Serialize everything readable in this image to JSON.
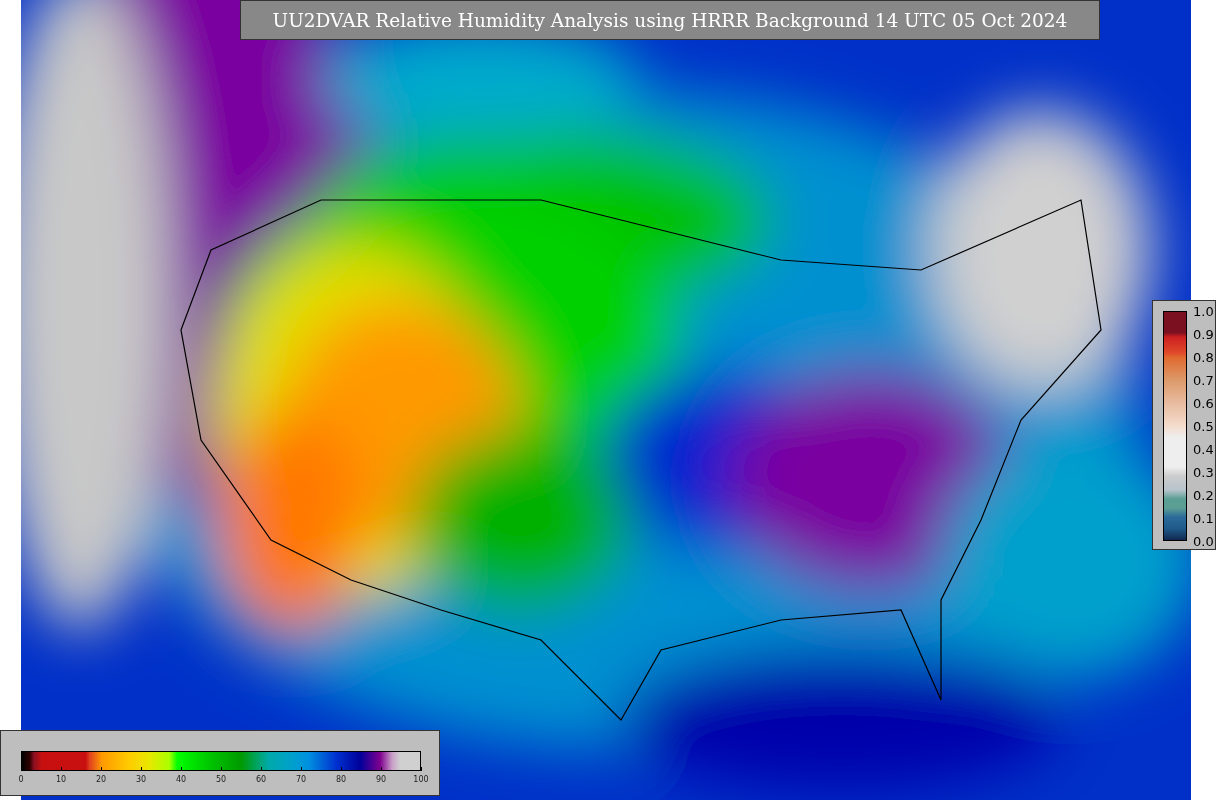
{
  "title": "UU2DVAR Relative Humidity Analysis using HRRR Background 14 UTC 05 Oct 2024",
  "station_colorbar": {
    "ticks": [
      "1.0",
      "0.9",
      "0.8",
      "0.7",
      "0.6",
      "0.5",
      "0.4",
      "0.3",
      "0.2",
      "0.1",
      "0.0"
    ]
  },
  "humidity_colorbar": {
    "ticks": [
      "0",
      "10",
      "20",
      "30",
      "40",
      "50",
      "60",
      "70",
      "80",
      "90",
      "100"
    ]
  }
}
